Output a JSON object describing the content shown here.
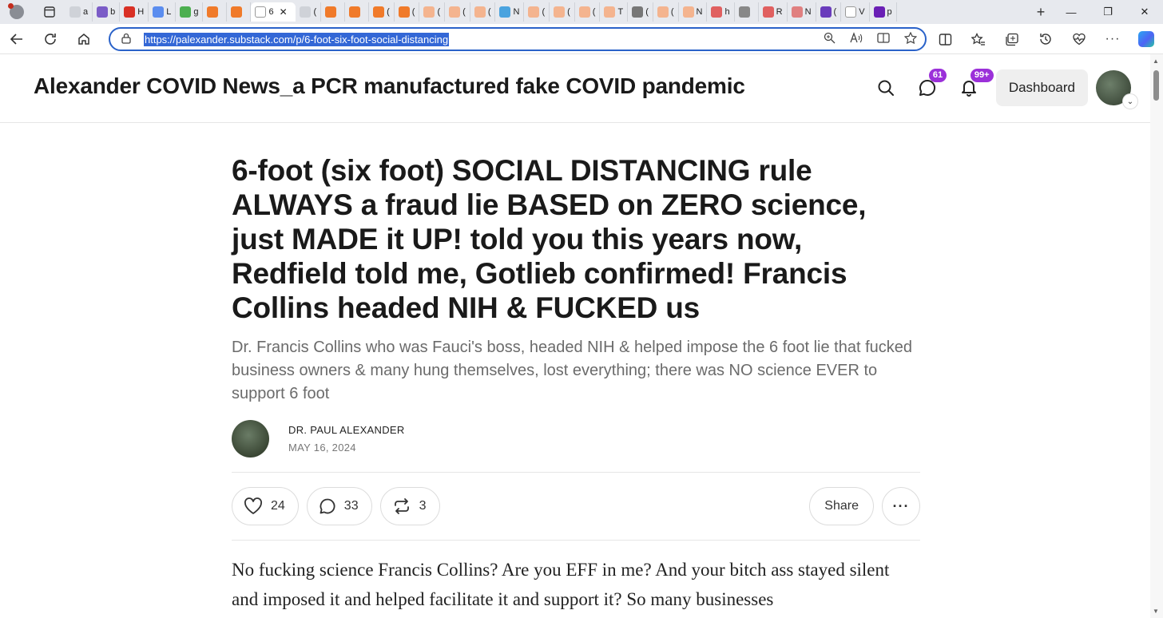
{
  "browser": {
    "active_tab_label": "6",
    "tabs": [
      {
        "label": "a",
        "color": "#cfd2d8"
      },
      {
        "label": "b",
        "color": "#7b5cc7"
      },
      {
        "label": "H",
        "color": "#d93025"
      },
      {
        "label": "L",
        "color": "#5b8def"
      },
      {
        "label": "g",
        "color": "#4caf50"
      },
      {
        "label": "",
        "color": "#f07a2a"
      },
      {
        "label": "",
        "color": "#f07a2a"
      },
      {
        "label": "6",
        "color": "#ffffff",
        "active": true
      },
      {
        "label": "(",
        "color": "#cfd2d8"
      },
      {
        "label": "",
        "color": "#f07a2a"
      },
      {
        "label": "",
        "color": "#f07a2a"
      },
      {
        "label": "(",
        "color": "#f07a2a"
      },
      {
        "label": "(",
        "color": "#f07a2a"
      },
      {
        "label": "(",
        "color": "#f4b48f"
      },
      {
        "label": "(",
        "color": "#f4b48f"
      },
      {
        "label": "(",
        "color": "#f4b48f"
      },
      {
        "label": "N",
        "color": "#4aa3df"
      },
      {
        "label": "(",
        "color": "#f4b48f"
      },
      {
        "label": "(",
        "color": "#f4b48f"
      },
      {
        "label": "(",
        "color": "#f4b48f"
      },
      {
        "label": "T",
        "color": "#f4b48f"
      },
      {
        "label": "(",
        "color": "#777777"
      },
      {
        "label": "(",
        "color": "#f4b48f"
      },
      {
        "label": "N",
        "color": "#f4b48f"
      },
      {
        "label": "h",
        "color": "#e06060"
      },
      {
        "label": "",
        "color": "#888888"
      },
      {
        "label": "R",
        "color": "#e06060"
      },
      {
        "label": "N",
        "color": "#e08080"
      },
      {
        "label": "(",
        "color": "#6a3cbc"
      },
      {
        "label": "V",
        "color": "#ffffff"
      },
      {
        "label": "p",
        "color": "#6a1fb5"
      }
    ],
    "url": "https://palexander.substack.com/p/6-foot-six-foot-social-distancing"
  },
  "site": {
    "title": "Alexander COVID News_a PCR manufactured fake COVID pandemic",
    "chat_badge": "61",
    "notifications_badge": "99+",
    "dashboard_label": "Dashboard"
  },
  "post": {
    "title": "6-foot (six foot) SOCIAL DISTANCING rule ALWAYS a fraud lie BASED on ZERO science, just MADE it UP! told you this years now, Redfield told me, Gotlieb confirmed! Francis Collins headed NIH & FUCKED us",
    "subtitle": "Dr. Francis Collins who was Fauci's boss, headed NIH & helped impose the 6 foot lie that fucked business owners & many hung themselves, lost everything; there was NO science EVER to support 6 foot",
    "author": "DR. PAUL ALEXANDER",
    "date": "MAY 16, 2024",
    "likes": "24",
    "comments": "33",
    "restacks": "3",
    "share_label": "Share",
    "body": "No fucking science Francis Collins? Are you EFF in me? And your bitch ass stayed silent and imposed it and helped facilitate it and support it? So many businesses"
  },
  "colors": {
    "accent": "#9b30d9",
    "url_highlight": "#3367d6",
    "addressbar_border": "#2a62c9"
  }
}
